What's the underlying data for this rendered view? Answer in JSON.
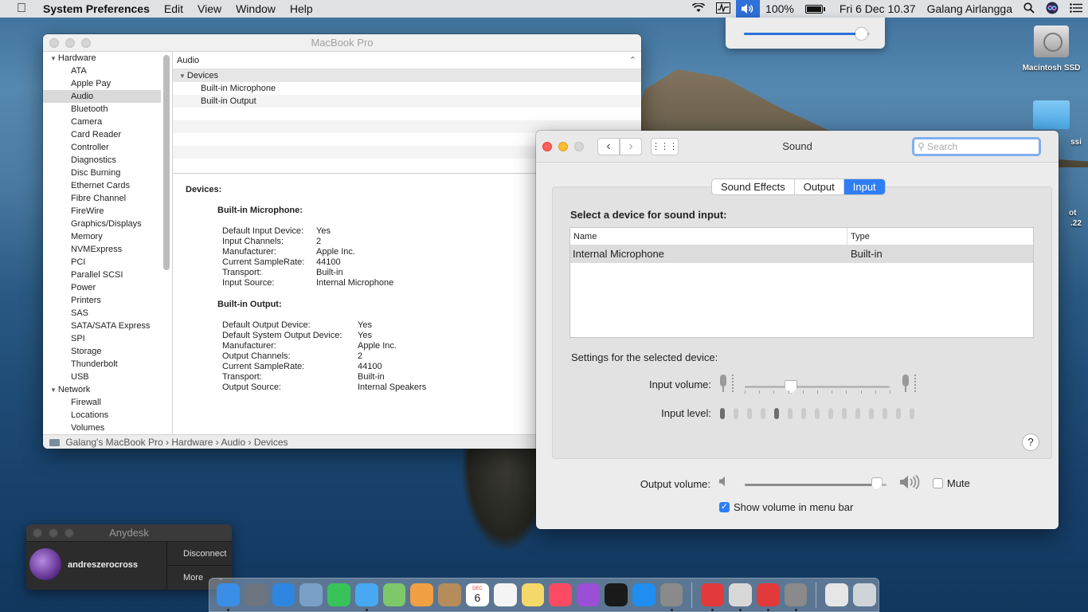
{
  "menubar": {
    "app_name": "System Preferences",
    "menus": [
      "Edit",
      "View",
      "Window",
      "Help"
    ],
    "battery": "100%",
    "datetime": "Fri 6 Dec 10.37",
    "user": "Galang Airlangga"
  },
  "volume_dropdown": {
    "level": 0.93
  },
  "desktop": {
    "icons": [
      {
        "label": "Macintosh SSD"
      }
    ],
    "partial_labels": [
      "ssi",
      "ot",
      ".22"
    ]
  },
  "sysinfo": {
    "title": "MacBook Pro",
    "sidebar": {
      "hardware_label": "Hardware",
      "hardware_items": [
        "ATA",
        "Apple Pay",
        "Audio",
        "Bluetooth",
        "Camera",
        "Card Reader",
        "Controller",
        "Diagnostics",
        "Disc Burning",
        "Ethernet Cards",
        "Fibre Channel",
        "FireWire",
        "Graphics/Displays",
        "Memory",
        "NVMExpress",
        "PCI",
        "Parallel SCSI",
        "Power",
        "Printers",
        "SAS",
        "SATA/SATA Express",
        "SPI",
        "Storage",
        "Thunderbolt",
        "USB"
      ],
      "selected": "Audio",
      "network_label": "Network",
      "network_items": [
        "Firewall",
        "Locations",
        "Volumes"
      ]
    },
    "header": "Audio",
    "tree": {
      "group": "Devices",
      "items": [
        "Built-in Microphone",
        "Built-in Output"
      ]
    },
    "detail": {
      "heading": "Devices:",
      "sections": [
        {
          "title": "Built-in Microphone:",
          "rows": [
            [
              "Default Input Device:",
              "Yes"
            ],
            [
              "Input Channels:",
              "2"
            ],
            [
              "Manufacturer:",
              "Apple Inc."
            ],
            [
              "Current SampleRate:",
              "44100"
            ],
            [
              "Transport:",
              "Built-in"
            ],
            [
              "Input Source:",
              "Internal Microphone"
            ]
          ]
        },
        {
          "title": "Built-in Output:",
          "rows": [
            [
              "Default Output Device:",
              "Yes"
            ],
            [
              "Default System Output Device:",
              "Yes"
            ],
            [
              "Manufacturer:",
              "Apple Inc."
            ],
            [
              "Output Channels:",
              "2"
            ],
            [
              "Current SampleRate:",
              "44100"
            ],
            [
              "Transport:",
              "Built-in"
            ],
            [
              "Output Source:",
              "Internal Speakers"
            ]
          ]
        }
      ]
    },
    "path": [
      "Galang's MacBook Pro",
      "Hardware",
      "Audio",
      "Devices"
    ]
  },
  "sound": {
    "title": "Sound",
    "search_placeholder": "Search",
    "tabs": [
      "Sound Effects",
      "Output",
      "Input"
    ],
    "active_tab": "Input",
    "section_title": "Select a device for sound input:",
    "columns": [
      "Name",
      "Type"
    ],
    "devices": [
      {
        "name": "Internal Microphone",
        "type": "Built-in"
      }
    ],
    "settings_label": "Settings for the selected device:",
    "input_volume_label": "Input volume:",
    "input_volume": 0.32,
    "input_level_label": "Input level:",
    "input_level_segments": 15,
    "input_level_active": [
      0,
      4
    ],
    "output_volume_label": "Output volume:",
    "output_volume": 0.93,
    "mute_label": "Mute",
    "mute_checked": false,
    "show_volume_label": "Show volume in menu bar",
    "show_volume_checked": true
  },
  "anydesk": {
    "title": "Anydesk",
    "user": "andreszerocross",
    "disconnect": "Disconnect",
    "more": "More"
  },
  "dock": {
    "calendar_month": "DEC",
    "calendar_day": "6",
    "apps": [
      {
        "name": "finder",
        "color": "#3a8ee6"
      },
      {
        "name": "launchpad",
        "color": "#6c7480"
      },
      {
        "name": "safari",
        "color": "#2f86e0"
      },
      {
        "name": "preview",
        "color": "#7aa0c8"
      },
      {
        "name": "facetime",
        "color": "#38c35a"
      },
      {
        "name": "messages",
        "color": "#48a8f2"
      },
      {
        "name": "maps",
        "color": "#7fc86a"
      },
      {
        "name": "photos",
        "color": "#f0a040"
      },
      {
        "name": "contacts",
        "color": "#b58d5a"
      },
      {
        "name": "calendar",
        "color": "#ffffff"
      },
      {
        "name": "reminders",
        "color": "#f4f4f4"
      },
      {
        "name": "notes",
        "color": "#f5d86a"
      },
      {
        "name": "music",
        "color": "#fb4a62"
      },
      {
        "name": "podcasts",
        "color": "#9b4fd6"
      },
      {
        "name": "tv",
        "color": "#1a1a1a"
      },
      {
        "name": "app-store",
        "color": "#1f8ef0"
      },
      {
        "name": "system-preferences",
        "color": "#8a8a8a"
      }
    ],
    "apps_right": [
      {
        "name": "anydesk",
        "color": "#e23a3a"
      },
      {
        "name": "textedit",
        "color": "#d8d8d8"
      },
      {
        "name": "anydesk-2",
        "color": "#e23a3a"
      },
      {
        "name": "automator",
        "color": "#8a8a8a"
      }
    ],
    "extras": [
      {
        "name": "documents",
        "color": "#e6e6e6"
      },
      {
        "name": "trash",
        "color": "#cfd4d8"
      }
    ]
  }
}
